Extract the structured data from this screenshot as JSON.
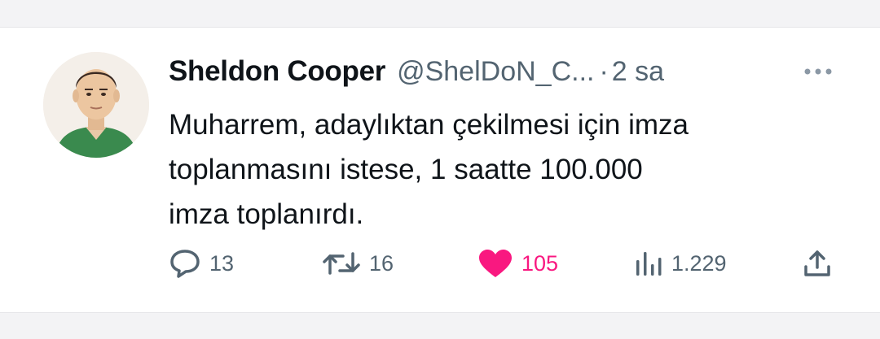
{
  "tweet": {
    "author_name": "Sheldon Cooper",
    "handle": "@ShelDoN_C...",
    "separator": "·",
    "timestamp": "2 sa",
    "text_lines": [
      "Muharrem, adaylıktan çekilmesi için imza",
      "toplanmasını istese, 1 saatte 100.000",
      "imza toplanırdı."
    ],
    "actions": {
      "replies": "13",
      "retweets": "16",
      "likes": "105",
      "views": "1.229"
    },
    "liked": true
  },
  "colors": {
    "text_primary": "#0f1419",
    "text_secondary": "#536471",
    "like_pink": "#f91880",
    "background": "#f3f3f5",
    "card": "#ffffff"
  },
  "icons": {
    "reply": "speech-bubble-icon",
    "retweet": "retweet-arrows-icon",
    "like": "heart-filled-icon",
    "views": "bar-chart-icon",
    "share": "upload-arrow-icon",
    "more": "ellipsis-icon"
  }
}
